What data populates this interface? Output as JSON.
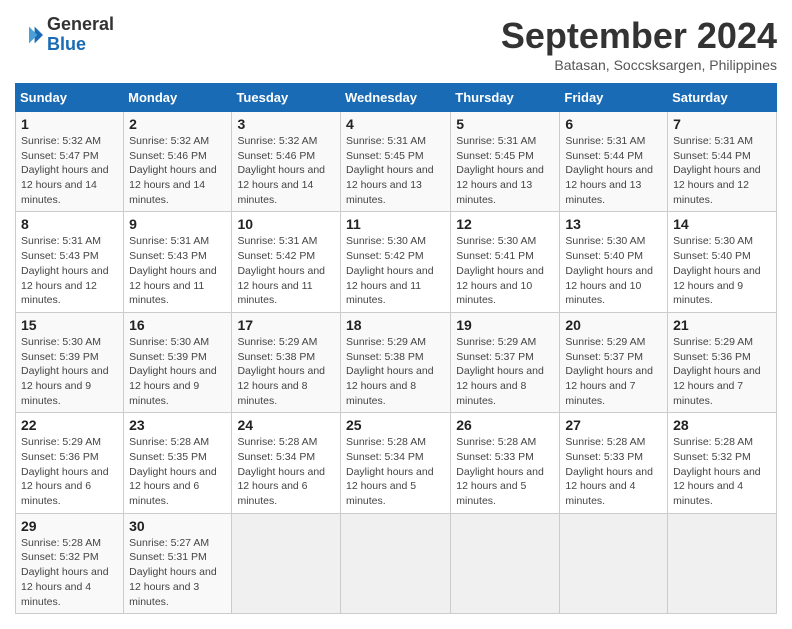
{
  "header": {
    "logo_line1": "General",
    "logo_line2": "Blue",
    "month_year": "September 2024",
    "location": "Batasan, Soccsksargen, Philippines"
  },
  "columns": [
    "Sunday",
    "Monday",
    "Tuesday",
    "Wednesday",
    "Thursday",
    "Friday",
    "Saturday"
  ],
  "weeks": [
    [
      {
        "day": "1",
        "sunrise": "5:32 AM",
        "sunset": "5:47 PM",
        "daylight": "12 hours and 14 minutes."
      },
      {
        "day": "2",
        "sunrise": "5:32 AM",
        "sunset": "5:46 PM",
        "daylight": "12 hours and 14 minutes."
      },
      {
        "day": "3",
        "sunrise": "5:32 AM",
        "sunset": "5:46 PM",
        "daylight": "12 hours and 14 minutes."
      },
      {
        "day": "4",
        "sunrise": "5:31 AM",
        "sunset": "5:45 PM",
        "daylight": "12 hours and 13 minutes."
      },
      {
        "day": "5",
        "sunrise": "5:31 AM",
        "sunset": "5:45 PM",
        "daylight": "12 hours and 13 minutes."
      },
      {
        "day": "6",
        "sunrise": "5:31 AM",
        "sunset": "5:44 PM",
        "daylight": "12 hours and 13 minutes."
      },
      {
        "day": "7",
        "sunrise": "5:31 AM",
        "sunset": "5:44 PM",
        "daylight": "12 hours and 12 minutes."
      }
    ],
    [
      {
        "day": "8",
        "sunrise": "5:31 AM",
        "sunset": "5:43 PM",
        "daylight": "12 hours and 12 minutes."
      },
      {
        "day": "9",
        "sunrise": "5:31 AM",
        "sunset": "5:43 PM",
        "daylight": "12 hours and 11 minutes."
      },
      {
        "day": "10",
        "sunrise": "5:31 AM",
        "sunset": "5:42 PM",
        "daylight": "12 hours and 11 minutes."
      },
      {
        "day": "11",
        "sunrise": "5:30 AM",
        "sunset": "5:42 PM",
        "daylight": "12 hours and 11 minutes."
      },
      {
        "day": "12",
        "sunrise": "5:30 AM",
        "sunset": "5:41 PM",
        "daylight": "12 hours and 10 minutes."
      },
      {
        "day": "13",
        "sunrise": "5:30 AM",
        "sunset": "5:40 PM",
        "daylight": "12 hours and 10 minutes."
      },
      {
        "day": "14",
        "sunrise": "5:30 AM",
        "sunset": "5:40 PM",
        "daylight": "12 hours and 9 minutes."
      }
    ],
    [
      {
        "day": "15",
        "sunrise": "5:30 AM",
        "sunset": "5:39 PM",
        "daylight": "12 hours and 9 minutes."
      },
      {
        "day": "16",
        "sunrise": "5:30 AM",
        "sunset": "5:39 PM",
        "daylight": "12 hours and 9 minutes."
      },
      {
        "day": "17",
        "sunrise": "5:29 AM",
        "sunset": "5:38 PM",
        "daylight": "12 hours and 8 minutes."
      },
      {
        "day": "18",
        "sunrise": "5:29 AM",
        "sunset": "5:38 PM",
        "daylight": "12 hours and 8 minutes."
      },
      {
        "day": "19",
        "sunrise": "5:29 AM",
        "sunset": "5:37 PM",
        "daylight": "12 hours and 8 minutes."
      },
      {
        "day": "20",
        "sunrise": "5:29 AM",
        "sunset": "5:37 PM",
        "daylight": "12 hours and 7 minutes."
      },
      {
        "day": "21",
        "sunrise": "5:29 AM",
        "sunset": "5:36 PM",
        "daylight": "12 hours and 7 minutes."
      }
    ],
    [
      {
        "day": "22",
        "sunrise": "5:29 AM",
        "sunset": "5:36 PM",
        "daylight": "12 hours and 6 minutes."
      },
      {
        "day": "23",
        "sunrise": "5:28 AM",
        "sunset": "5:35 PM",
        "daylight": "12 hours and 6 minutes."
      },
      {
        "day": "24",
        "sunrise": "5:28 AM",
        "sunset": "5:34 PM",
        "daylight": "12 hours and 6 minutes."
      },
      {
        "day": "25",
        "sunrise": "5:28 AM",
        "sunset": "5:34 PM",
        "daylight": "12 hours and 5 minutes."
      },
      {
        "day": "26",
        "sunrise": "5:28 AM",
        "sunset": "5:33 PM",
        "daylight": "12 hours and 5 minutes."
      },
      {
        "day": "27",
        "sunrise": "5:28 AM",
        "sunset": "5:33 PM",
        "daylight": "12 hours and 4 minutes."
      },
      {
        "day": "28",
        "sunrise": "5:28 AM",
        "sunset": "5:32 PM",
        "daylight": "12 hours and 4 minutes."
      }
    ],
    [
      {
        "day": "29",
        "sunrise": "5:28 AM",
        "sunset": "5:32 PM",
        "daylight": "12 hours and 4 minutes."
      },
      {
        "day": "30",
        "sunrise": "5:27 AM",
        "sunset": "5:31 PM",
        "daylight": "12 hours and 3 minutes."
      },
      null,
      null,
      null,
      null,
      null
    ]
  ]
}
